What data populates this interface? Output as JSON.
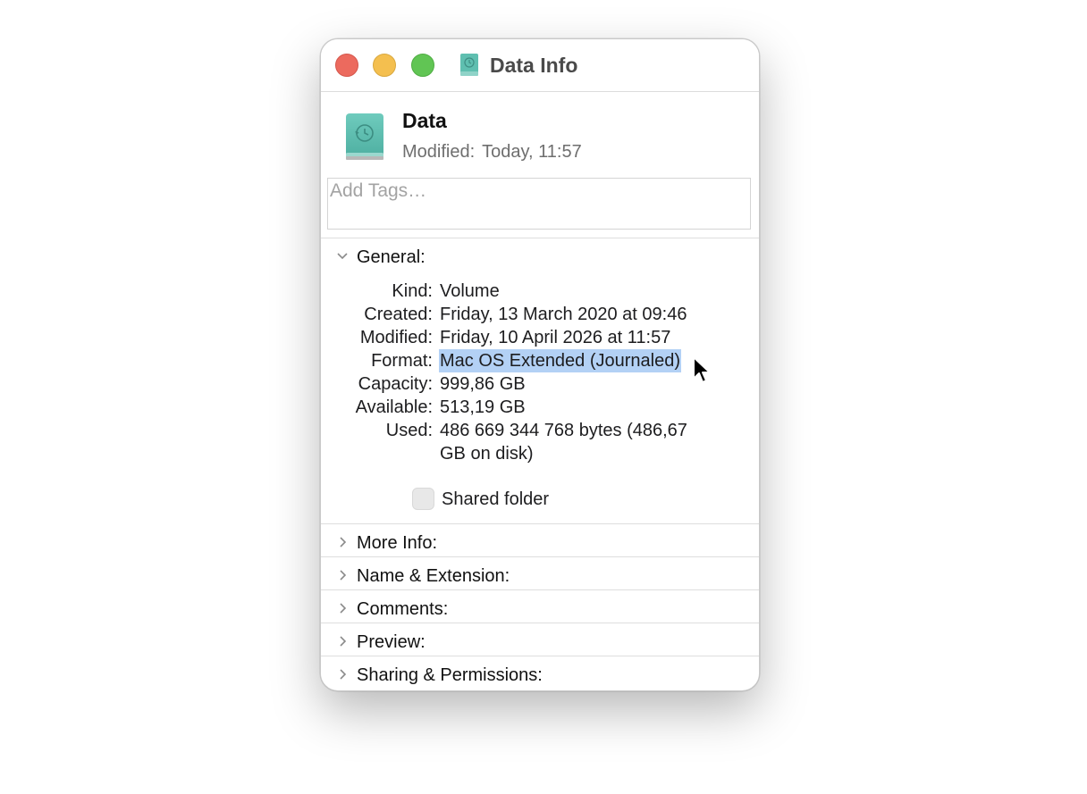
{
  "window": {
    "title": "Data Info",
    "title_icon": "time-machine-drive-icon"
  },
  "header": {
    "name": "Data",
    "modified_label": "Modified:",
    "modified_value": "Today, 11:57",
    "icon": "time-machine-drive-icon"
  },
  "tags": {
    "placeholder": "Add Tags…",
    "value": ""
  },
  "general": {
    "label": "General:",
    "expanded": true,
    "rows": [
      {
        "key": "Kind:",
        "value": "Volume"
      },
      {
        "key": "Created:",
        "value": "Friday, 13 March 2020 at 09:46"
      },
      {
        "key": "Modified:",
        "value": "Friday, 10 April 2026 at 11:57"
      },
      {
        "key": "Format:",
        "value": "Mac OS Extended (Journaled)"
      },
      {
        "key": "Capacity:",
        "value": "999,86 GB"
      },
      {
        "key": "Available:",
        "value": "513,19 GB"
      },
      {
        "key": "Used:",
        "value": "486 669 344 768 bytes (486,67",
        "value_line2": "GB on disk)"
      }
    ],
    "shared_folder_label": "Shared folder",
    "shared_folder_checked": false
  },
  "sections": [
    {
      "label": "More Info:",
      "expanded": false
    },
    {
      "label": "Name & Extension:",
      "expanded": false
    },
    {
      "label": "Comments:",
      "expanded": false
    },
    {
      "label": "Preview:",
      "expanded": false
    },
    {
      "label": "Sharing & Permissions:",
      "expanded": false
    }
  ],
  "colors": {
    "close": "#ec6a5e",
    "minimize": "#f4bf4f",
    "zoom": "#61c554",
    "selection": "#b3d1f5",
    "drive_teal": "#5fbfb0"
  }
}
